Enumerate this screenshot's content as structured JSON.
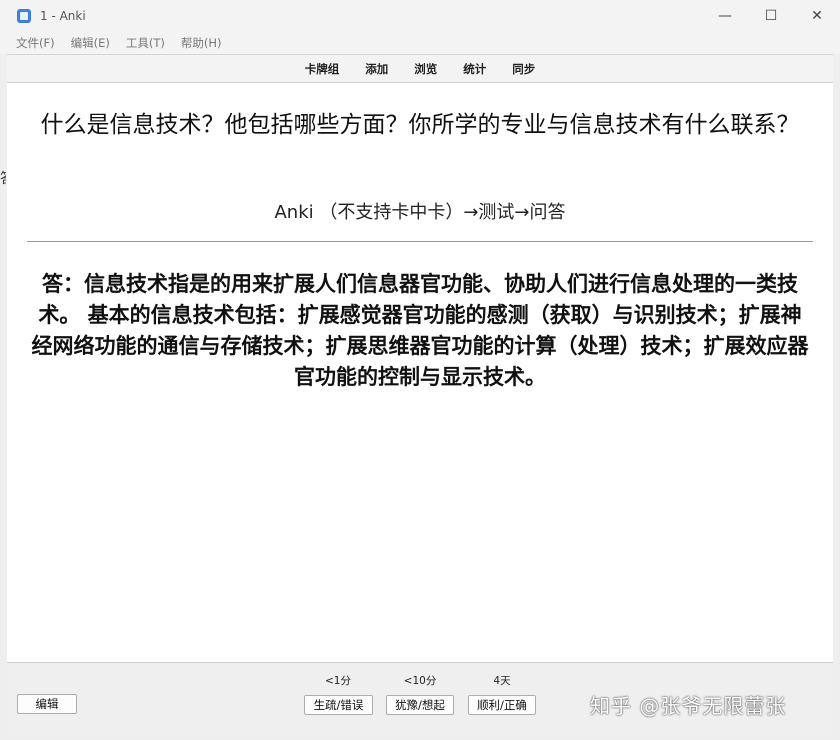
{
  "window": {
    "title": "1 - Anki",
    "controls": {
      "minimize": "—",
      "maximize": "☐",
      "close": "✕"
    }
  },
  "menu": [
    "文件(F)",
    "编辑(E)",
    "工具(T)",
    "帮助(H)"
  ],
  "toolbar": [
    "卡牌组",
    "添加",
    "浏览",
    "统计",
    "同步"
  ],
  "card": {
    "question": "什么是信息技术？他包括哪些方面？你所学的专业与信息技术有什么联系？",
    "hint": "Anki （不支持卡中卡）→测试→问答",
    "answer": "答：信息技术指是的用来扩展人们信息器官功能、协助人们进行信息处理的一类技术。 基本的信息技术包括：扩展感觉器官功能的感测（获取）与识别技术；扩展神经网络功能的通信与存储技术；扩展思维器官功能的计算（处理）技术；扩展效应器官功能的控制与显示技术。"
  },
  "side_mark": "答",
  "bottom": {
    "edit_label": "编辑",
    "answers": [
      {
        "interval": "<1分",
        "label": "生疏/错误"
      },
      {
        "interval": "<10分",
        "label": "犹豫/想起"
      },
      {
        "interval": "4天",
        "label": "顺利/正确"
      }
    ]
  },
  "watermark": "知乎 @张爷无限蕾张"
}
